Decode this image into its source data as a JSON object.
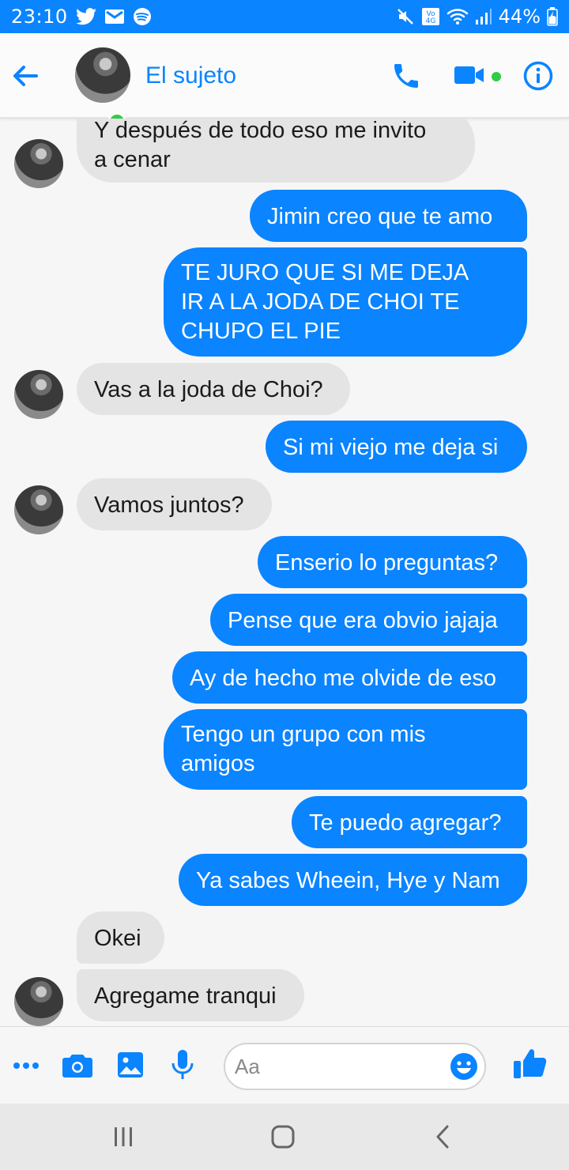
{
  "status_bar": {
    "time": "23:10",
    "battery": "44%",
    "net_label_top": "Vo",
    "net_label_bottom": "4G",
    "icons": [
      "twitter-icon",
      "gmail-icon",
      "spotify-icon",
      "mute-icon",
      "volte-icon",
      "wifi-icon",
      "signal-icon",
      "battery-icon"
    ]
  },
  "header": {
    "contact_name": "El sujeto",
    "icons": [
      "back-arrow-icon",
      "phone-icon",
      "video-camera-icon",
      "info-icon"
    ]
  },
  "messages": [
    {
      "side": "in",
      "text_lines": [
        "Y después de todo eso me invito",
        "a cenar"
      ],
      "avatar": true
    },
    {
      "side": "out",
      "text_lines": [
        "Jimin creo que te amo"
      ]
    },
    {
      "side": "out",
      "text_lines": [
        "TE JURO QUE SI ME DEJA",
        "IR A LA JODA DE CHOI TE",
        "CHUPO EL PIE"
      ]
    },
    {
      "side": "in",
      "text_lines": [
        "Vas a la joda de Choi?"
      ],
      "avatar": true
    },
    {
      "side": "out",
      "text_lines": [
        "Si mi viejo me deja si"
      ]
    },
    {
      "side": "in",
      "text_lines": [
        "Vamos juntos?"
      ],
      "avatar": true
    },
    {
      "side": "out",
      "text_lines": [
        "Enserio lo preguntas?"
      ]
    },
    {
      "side": "out",
      "text_lines": [
        "Pense que era obvio jajaja"
      ]
    },
    {
      "side": "out",
      "text_lines": [
        "Ay de hecho me olvide de eso"
      ]
    },
    {
      "side": "out",
      "text_lines": [
        "Tengo un grupo con mis",
        "amigos"
      ]
    },
    {
      "side": "out",
      "text_lines": [
        "Te puedo agregar?"
      ]
    },
    {
      "side": "out",
      "text_lines": [
        "Ya sabes Wheein, Hye y Nam"
      ]
    },
    {
      "side": "in",
      "text_lines": [
        "Okei"
      ],
      "avatar": false
    },
    {
      "side": "in",
      "text_lines": [
        "Agregame tranqui"
      ],
      "avatar": true
    }
  ],
  "composer": {
    "placeholder": "Aa",
    "icons": [
      "more-icon",
      "camera-icon",
      "image-icon",
      "microphone-icon",
      "emoji-icon",
      "thumbs-up-icon"
    ]
  },
  "nav_bar": {
    "icons": [
      "recent-apps-icon",
      "home-icon",
      "back-icon"
    ]
  },
  "colors": {
    "accent": "#0a84ff",
    "incoming_bubble": "#e4e4e4",
    "online": "#31cc46",
    "background": "#f6f6f6"
  }
}
